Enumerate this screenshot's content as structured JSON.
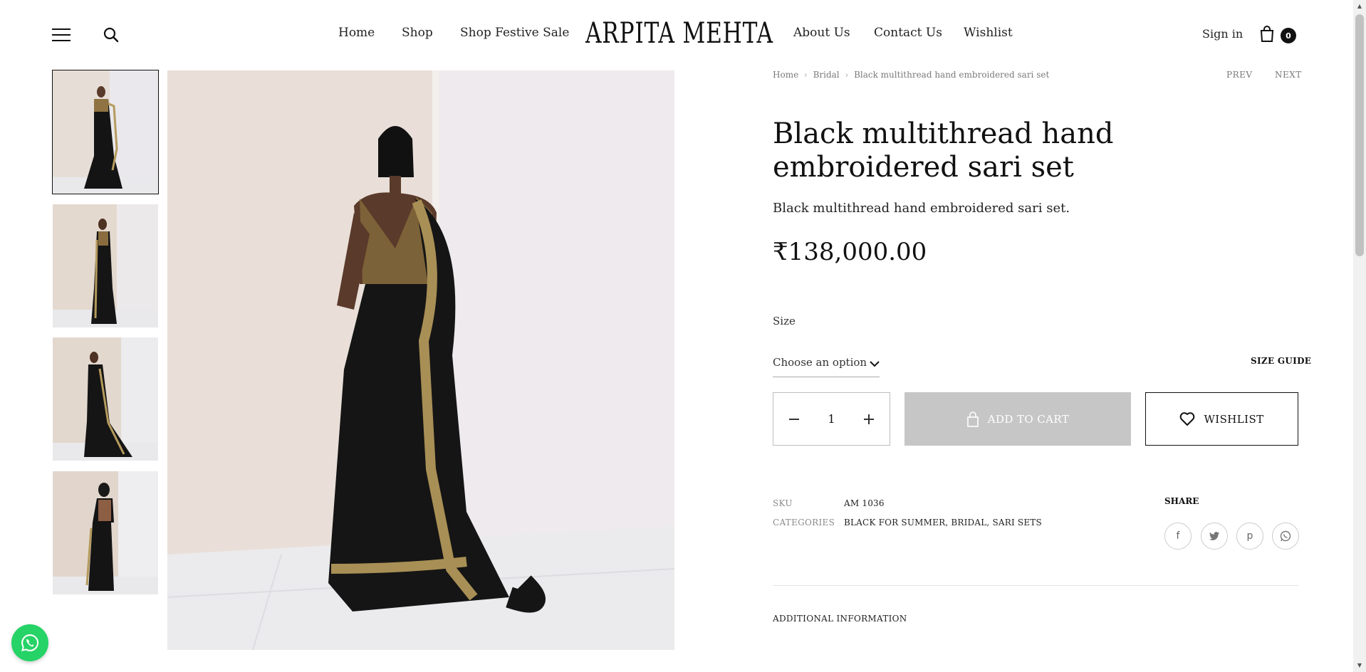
{
  "header": {
    "nav_left": [
      "Home",
      "Shop",
      "Shop Festive Sale"
    ],
    "logo": "ARPITA MEHTA",
    "nav_right": [
      "About Us",
      "Contact Us",
      "Wishlist"
    ],
    "signin": "Sign in",
    "cart_count": "0"
  },
  "breadcrumb": [
    "Home",
    "Bridal",
    "Black multithread hand embroidered sari set"
  ],
  "pager": {
    "prev": "PREV",
    "next": "NEXT"
  },
  "product": {
    "title": "Black multithread hand embroidered sari set",
    "short_desc": "Black multithread hand embroidered sari set.",
    "price": "₹138,000.00",
    "size_label": "Size",
    "size_select_value": "Choose an option",
    "size_guide": "SIZE GUIDE",
    "quantity": "1",
    "add_to_cart": "ADD TO CART",
    "wishlist": "WISHLIST",
    "sku_label": "SKU",
    "sku": "AM 1036",
    "categories_label": "CATEGORIES",
    "categories": "BLACK FOR SUMMER, BRIDAL, SARI SETS",
    "share_label": "SHARE",
    "additional_info": "ADDITIONAL INFORMATION"
  },
  "colors": {
    "accent": "#111111",
    "button_disabled": "#c6c6c6",
    "whatsapp": "#25d366"
  },
  "icons": [
    "hamburger-icon",
    "search-icon",
    "bag-icon",
    "chevron-down-icon",
    "minus-icon",
    "plus-icon",
    "lock-bag-icon",
    "heart-icon",
    "facebook-icon",
    "twitter-icon",
    "pinterest-icon",
    "whatsapp-icon"
  ]
}
